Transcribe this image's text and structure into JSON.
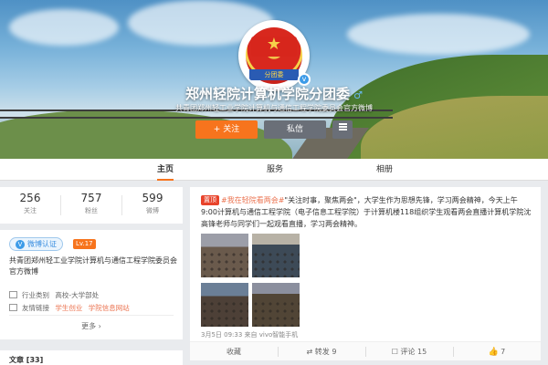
{
  "profile": {
    "name": "郑州轻院计算机学院分团委",
    "description": "共青团郑州轻工业学院计算机与通信工程学院委员会官方微博",
    "avatar_ribbon": "分团委",
    "follow_label": "+ 关注",
    "message_label": "私信",
    "verified_mark": "v",
    "gender_icon": "♂"
  },
  "nav": {
    "tabs": [
      "主页",
      "服务",
      "相册"
    ],
    "active": "主页"
  },
  "stats": [
    {
      "num": "256",
      "label": "关注"
    },
    {
      "num": "757",
      "label": "粉丝"
    },
    {
      "num": "599",
      "label": "微博"
    }
  ],
  "info": {
    "verify_label": "微博认证",
    "level_label": "Lv.17",
    "description": "共青团郑州轻工业学院计算机与通信工程学院委员会官方微博",
    "industry_label": "行业类别",
    "industry_value": "高校-大学部处",
    "links_label": "友情链接",
    "link1": "学生创业",
    "link2": "学院信息网站",
    "more_label": "更多"
  },
  "articles": {
    "title": "文章 [33]"
  },
  "post": {
    "hot_label": "置顶",
    "topic": "#我在轻院看两会#",
    "body": "\"关注时事，聚焦两会\"，大学生作为思想先锋，学习两会精神，今天上午9:00计算机与通信工程学院（电子信息工程学院）于计算机楼118组织学生观看两会直播计算机学院沈高锋老师与同学们一起观看直播，学习两会精神。",
    "meta": "3月5日 09:33 来自 vivo智能手机",
    "actions": {
      "favorite": "收藏",
      "repost": "转发 9",
      "comment": "评论 15",
      "like": "7"
    }
  },
  "colors": {
    "accent": "#f7741d",
    "link": "#eb7350",
    "verified": "#3c9be8",
    "hot_tag": "#e8432b"
  },
  "icons": {
    "more_menu": "menu-icon",
    "like": "thumbs-up-icon"
  }
}
